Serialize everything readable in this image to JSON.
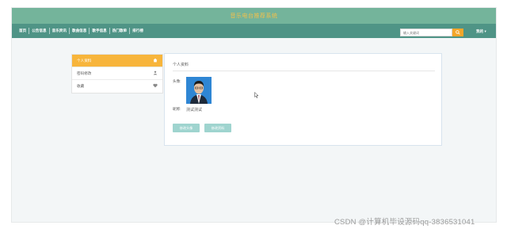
{
  "header": {
    "title": "音乐电台推荐系统"
  },
  "nav": {
    "items": [
      {
        "label": "首页"
      },
      {
        "label": "公告信息"
      },
      {
        "label": "音乐资讯"
      },
      {
        "label": "歌曲信息"
      },
      {
        "label": "歌手信息"
      },
      {
        "label": "热门歌单"
      },
      {
        "label": "排行榜"
      }
    ],
    "search_placeholder": "输入关键词",
    "search_icon": "search-icon",
    "user_label": "我的 ▾"
  },
  "sidebar": {
    "items": [
      {
        "label": "个人资料",
        "icon": "home-icon",
        "active": true
      },
      {
        "label": "密码修改",
        "icon": "user-icon",
        "active": false
      },
      {
        "label": "收藏",
        "icon": "heart-icon",
        "active": false
      }
    ]
  },
  "profile": {
    "title": "个人资料",
    "avatar_label": "头像:",
    "nickname_label": "昵称:",
    "nickname_value": "测试测试",
    "btn_update_avatar": "修改头像",
    "btn_update_info": "修改资料"
  },
  "watermark": "CSDN @计算机毕设源码qq-3836531041",
  "colors": {
    "title_bar": "#74b49b",
    "nav_bar": "#4f9486",
    "title_text": "#f4c04a",
    "accent": "#f7b53b",
    "button": "#9fd4cf"
  }
}
